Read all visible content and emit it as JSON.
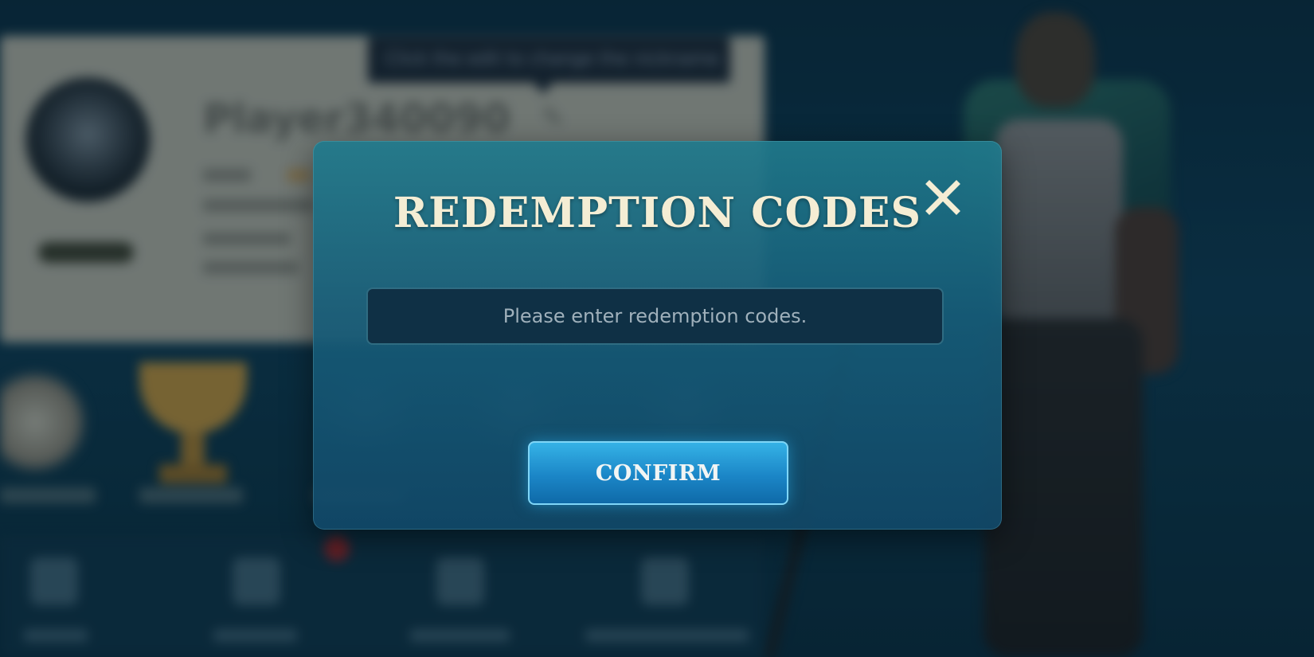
{
  "background": {
    "player_name": "Player340090",
    "tooltip_text": "Click the edit to change the nickname"
  },
  "modal": {
    "title": "REDEMPTION CODES",
    "input_placeholder": "Please enter redemption codes.",
    "input_value": "",
    "confirm_label": "CONFIRM",
    "close_icon": "close-x-icon"
  },
  "colors": {
    "title_text": "#f4edd4",
    "confirm_button": "#1b86c7",
    "modal_background": "#1a6a86"
  }
}
